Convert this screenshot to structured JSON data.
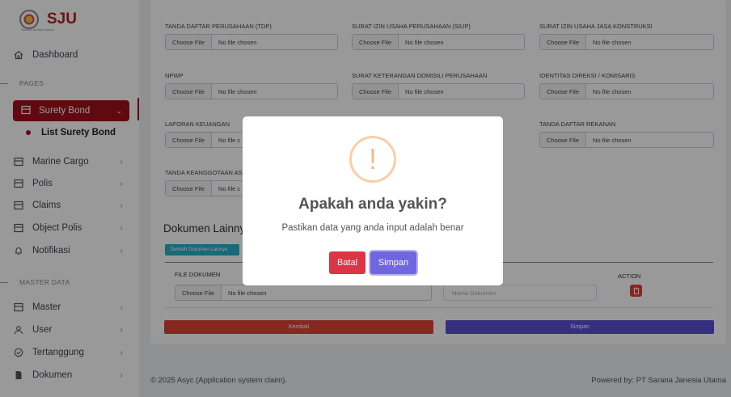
{
  "app": {
    "logo_text": "SJU",
    "logo_subtitle": "Sarana Janesia Utama"
  },
  "sidebar": {
    "dashboard": "Dashboard",
    "section_pages": "PAGES",
    "surety_bond": "Surety Bond",
    "list_surety_bond": "List Surety Bond",
    "items": [
      {
        "label": "Marine Cargo",
        "icon": "box-icon"
      },
      {
        "label": "Polis",
        "icon": "box-icon"
      },
      {
        "label": "Claims",
        "icon": "box-icon"
      },
      {
        "label": "Object Polis",
        "icon": "box-icon"
      },
      {
        "label": "Notifikasi",
        "icon": "bell-icon"
      }
    ],
    "section_master": "MASTER DATA",
    "master_items": [
      {
        "label": "Master",
        "icon": "box-icon"
      },
      {
        "label": "User",
        "icon": "user-icon"
      },
      {
        "label": "Tertanggung",
        "icon": "shield-icon"
      },
      {
        "label": "Dokumen",
        "icon": "file-icon"
      }
    ]
  },
  "form": {
    "choose_file": "Choose File",
    "no_file": "No file chosen",
    "no_file_partial": "No file c",
    "fields": {
      "tdp": "TANDA DAFTAR PERUSAHAAN (TDP)",
      "siup": "SURAT IZIN USAHA PERUSAHAAN (SIUP)",
      "sijk": "SURAT IZIN USAHA JASA KONSTRUKSI",
      "npwp": "NPWP",
      "skdp": "SURAT KETERANGAN DOMISILI PERUSAHAAN",
      "direksi": "IDENTITAS DIREKSI / KOMISARIS",
      "laporan": "LAPORAN KEUANGAN",
      "rekanan": "TANDA DAFTAR REKANAN",
      "keanggotaan": "TANDA KEANGGOTAAN AS"
    },
    "dokumen_lainnya": "Dokumen Lainnya",
    "tambah_button": "Tambah Dokumen Lainnya",
    "col_file": "FILE DOKUMEN",
    "col_action": "ACTION",
    "nama_placeholder": "Nama Dokumen",
    "kembali": "Kembali",
    "simpan": "Simpan"
  },
  "footer": {
    "left": "© 2025 Asyc (Application system claim).",
    "right": "Powered by: PT Sarana Janesia Utama"
  },
  "modal": {
    "icon": "!",
    "title": "Apakah anda yakin?",
    "text": "Pastikan data yang anda input adalah benar",
    "cancel": "Batal",
    "confirm": "Simpan"
  },
  "colors": {
    "brand": "#a0121c",
    "danger": "#e0443a",
    "primary": "#5b4fd6",
    "modal_confirm": "#7066e0",
    "modal_cancel": "#dc3545",
    "warning": "#f8bb86"
  }
}
